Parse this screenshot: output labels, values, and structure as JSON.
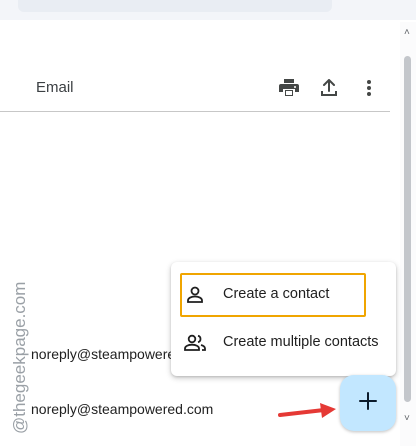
{
  "header": {
    "column_email": "Email",
    "print_icon": "print-icon",
    "export_icon": "export-icon",
    "more_icon": "more-vert-icon"
  },
  "rows": [
    {
      "email": "noreply@steampowered"
    },
    {
      "email": "noreply@steampowered.com"
    }
  ],
  "menu": {
    "items": [
      {
        "label": "Create a contact",
        "icon": "person-icon"
      },
      {
        "label": "Create multiple contacts",
        "icon": "people-icon"
      }
    ]
  },
  "fab": {
    "icon": "plus-icon"
  },
  "watermark": {
    "text": "@thegeekpage.com"
  },
  "colors": {
    "fab": "#c2e7ff",
    "highlight": "#f0a500",
    "arrow": "#e53935",
    "icon": "#444746"
  }
}
